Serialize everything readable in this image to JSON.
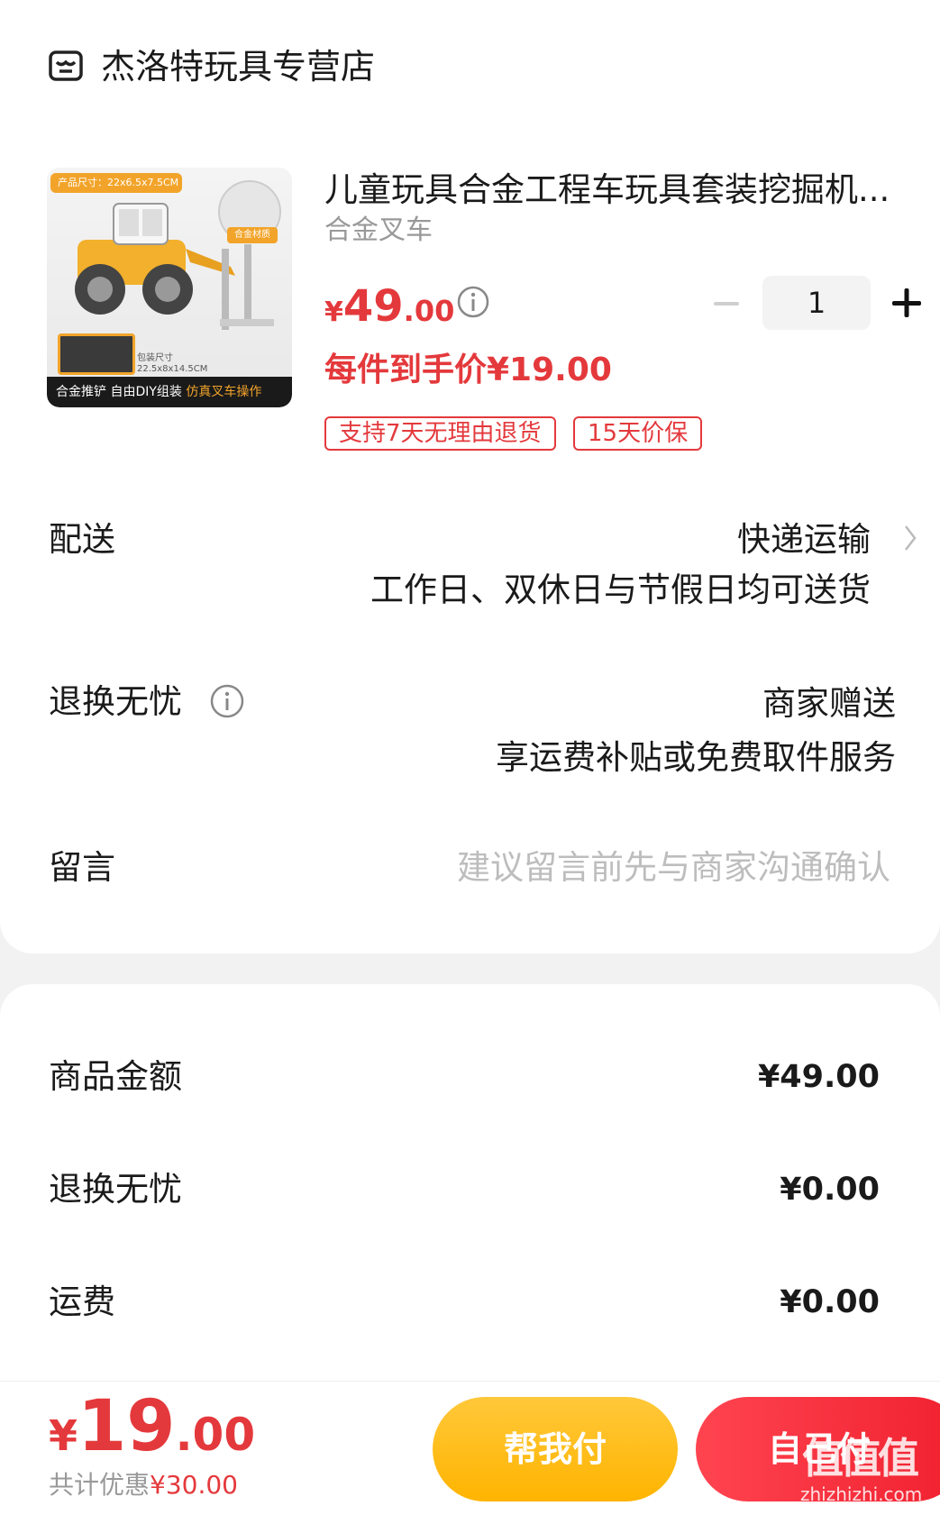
{
  "shop": {
    "name": "杰洛特玩具专营店",
    "icon": "shop-icon"
  },
  "product": {
    "title": "儿童玩具合金工程车玩具套装挖掘机...",
    "spec": "合金叉车",
    "price_currency": "¥",
    "price_int": "49",
    "price_dec": ".00",
    "final_price": "每件到手价¥19.00",
    "quantity": "1",
    "tags": [
      "支持7天无理由退货",
      "15天价保"
    ],
    "image_text": {
      "size_tag": "产品尺寸：22x6.5x7.5CM",
      "material_tag": "合金材质",
      "pack_label": "包装尺寸",
      "pack_size": "22.5x8x14.5CM",
      "banner_a": "合金推铲 自由DIY组装 ",
      "banner_b": "仿真叉车操作"
    }
  },
  "delivery": {
    "label": "配送",
    "method": "快递运输",
    "note": "工作日、双休日与节假日均可送货"
  },
  "returns": {
    "label": "退换无忧",
    "gift": "商家赠送",
    "desc": "享运费补贴或免费取件服务"
  },
  "message": {
    "label": "留言",
    "placeholder": "建议留言前先与商家沟通确认"
  },
  "summary": {
    "rows": [
      {
        "label": "商品金额",
        "value": "¥49.00"
      },
      {
        "label": "退换无忧",
        "value": "¥0.00"
      },
      {
        "label": "运费",
        "value": "¥0.00"
      }
    ]
  },
  "footer": {
    "total_currency": "¥",
    "total_int": "19",
    "total_dec": ".00",
    "discount_label": "共计优惠",
    "discount_value": "¥30.00",
    "help_pay": "帮我付",
    "self_pay": "自己付",
    "watermark": "值值值",
    "watermark_site": "zhizhizhi.com"
  },
  "colors": {
    "accent": "#e4393c",
    "help_button": "#ffb400",
    "self_button": "#f0202f"
  }
}
